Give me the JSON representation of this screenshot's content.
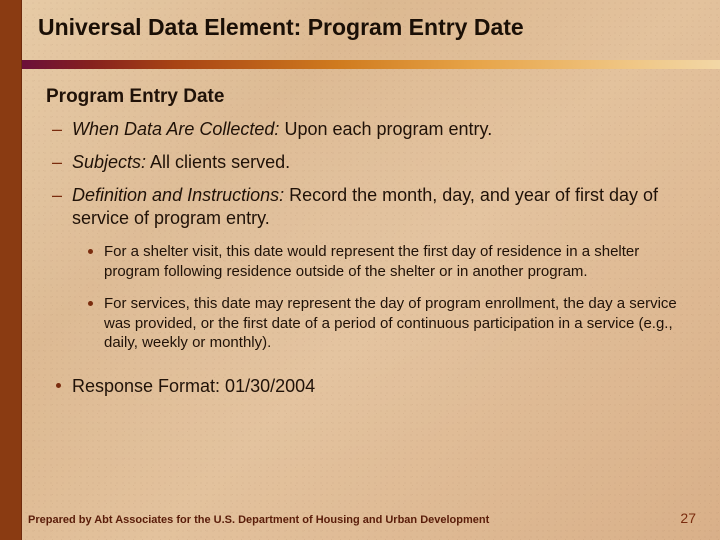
{
  "title": "Universal Data Element: Program Entry Date",
  "section_title": "Program Entry Date",
  "bullets": {
    "b1": {
      "lead": "When Data Are Collected:",
      "text": " Upon each program entry."
    },
    "b2": {
      "lead": "Subjects:",
      "text": "  All clients served."
    },
    "b3": {
      "lead": "Definition and Instructions:",
      "text": " Record the month, day, and year of first day of service of program entry."
    }
  },
  "subbullets": {
    "s1": "For a shelter visit, this date would represent the first day of residence in a shelter program following residence outside of the shelter or in another program.",
    "s2": "For services, this date may represent the day of program enrollment, the day a service was provided, or the first date of a period of continuous participation in a service (e.g., daily, weekly or monthly)."
  },
  "response_format": "Response Format: 01/30/2004",
  "footer_text": "Prepared by Abt Associates for the U.S. Department of Housing and Urban Development",
  "page_number": "27"
}
